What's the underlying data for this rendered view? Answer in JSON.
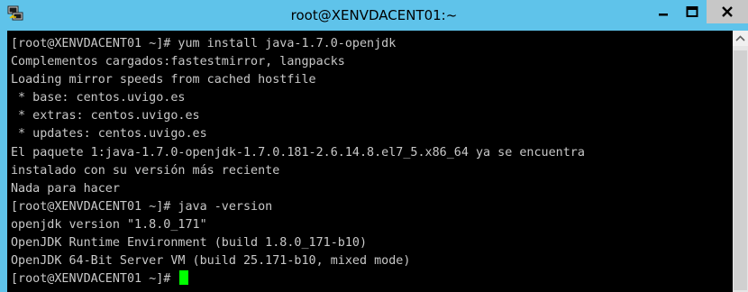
{
  "window": {
    "title": "root@XENVDACENT01:~",
    "icons": {
      "app": "putty-icon",
      "minimize": "minimize-icon",
      "maximize": "maximize-icon",
      "close": "close-icon"
    }
  },
  "terminal": {
    "lines": [
      "[root@XENVDACENT01 ~]# yum install java-1.7.0-openjdk",
      "Complementos cargados:fastestmirror, langpacks",
      "Loading mirror speeds from cached hostfile",
      " * base: centos.uvigo.es",
      " * extras: centos.uvigo.es",
      " * updates: centos.uvigo.es",
      "El paquete 1:java-1.7.0-openjdk-1.7.0.181-2.6.14.8.el7_5.x86_64 ya se encuentra",
      "instalado con su versión más reciente",
      "Nada para hacer",
      "[root@XENVDACENT01 ~]# java -version",
      "openjdk version \"1.8.0_171\"",
      "OpenJDK Runtime Environment (build 1.8.0_171-b10)",
      "OpenJDK 64-Bit Server VM (build 25.171-b10, mixed mode)"
    ],
    "prompt": "[root@XENVDACENT01 ~]# ",
    "text_color": "#c8c8c8",
    "cursor_color": "#00ff00",
    "background": "#000000"
  },
  "colors": {
    "titlebar": "#5fc3ea",
    "close_button": "#c7c7c7"
  }
}
